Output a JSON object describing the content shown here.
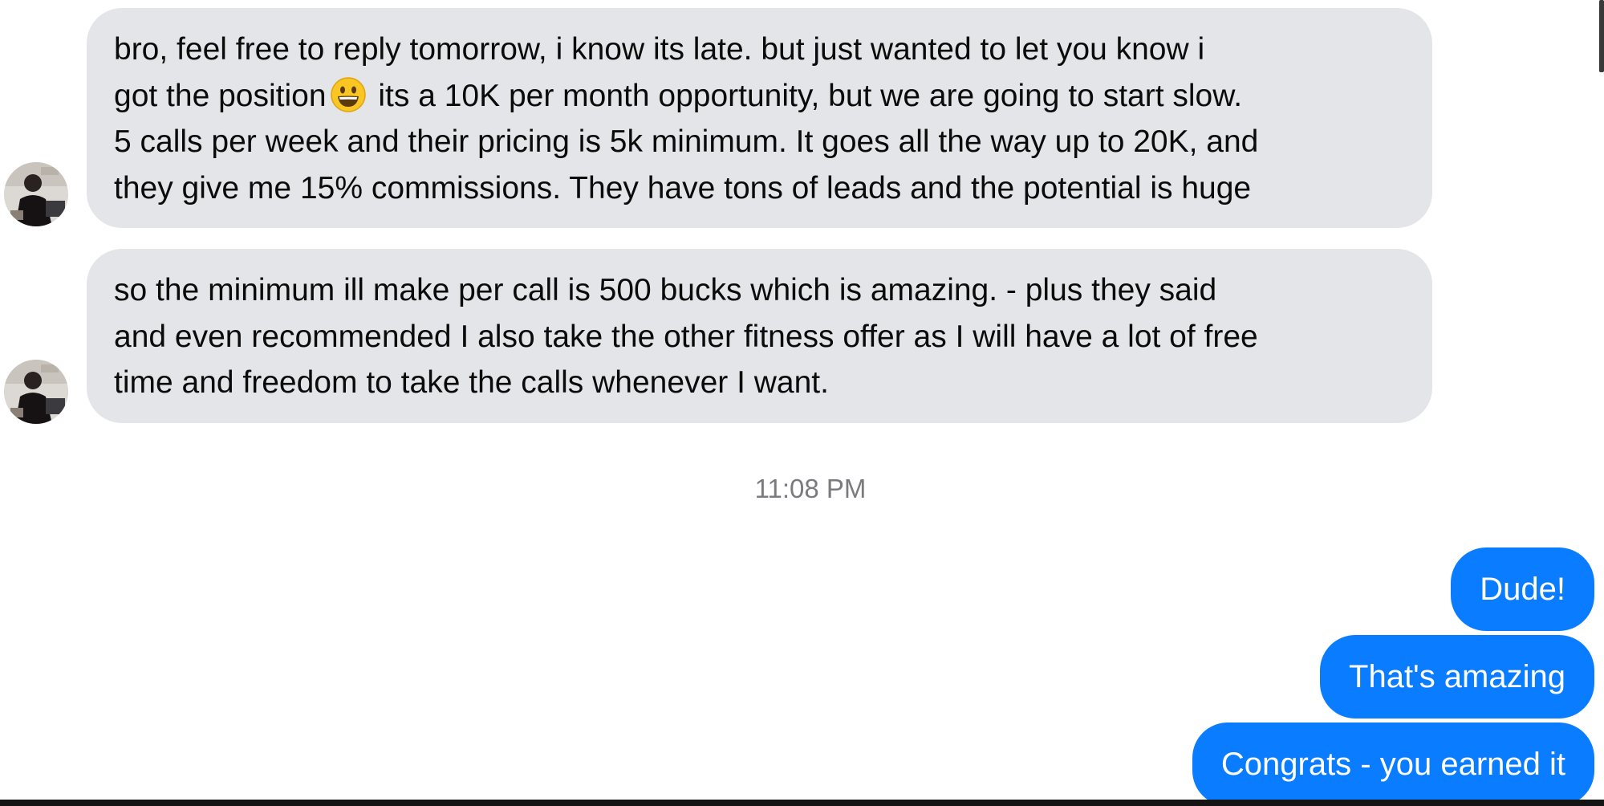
{
  "conversation": {
    "incoming": [
      {
        "lines": [
          "bro, feel free to reply tomorrow, i know its late. but just wanted to let you know i",
          "got the position",
          " its a 10K per month opportunity, but we are going to start slow.",
          "5 calls per week and their pricing is 5k minimum. It goes all the way up to 20K, and",
          "they give me 15% commissions. They have tons of leads and the potential is huge"
        ],
        "emoji": "grinning-face-emoji"
      },
      {
        "lines": [
          "so the minimum ill make per call is 500 bucks which is amazing. - plus they said",
          "and even recommended I also take the other fitness offer as I will have a lot of free",
          "time and freedom to take the calls whenever I want."
        ]
      }
    ],
    "timestamp": "11:08 PM",
    "outgoing": [
      {
        "text": "Dude!"
      },
      {
        "text": "That's amazing"
      },
      {
        "text": "Congrats - you earned it"
      }
    ]
  },
  "colors": {
    "incoming_bubble": "#e4e5e9",
    "outgoing_bubble": "#0a7cff",
    "timestamp_text": "#7b7b7f"
  }
}
